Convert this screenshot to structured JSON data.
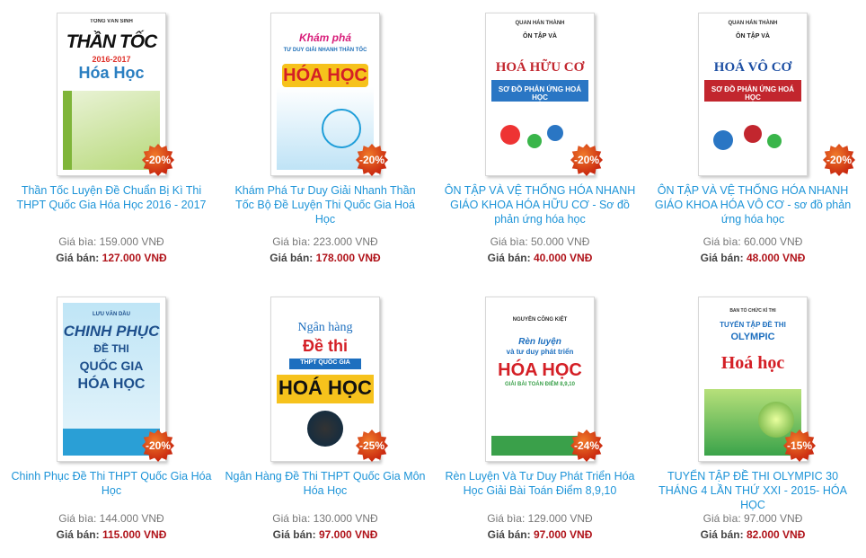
{
  "products": [
    {
      "title": "Thần Tốc Luyện Đề Chuẩn Bị Kì Thi THPT Quốc Gia Hóa Học 2016 - 2017",
      "discount": "-20%",
      "list_label": "Giá bìa:",
      "list_price": "159.000 VNĐ",
      "sale_label": "Giá bán:",
      "sale_price": "127.000 VNĐ",
      "cover": {
        "author": "TỐNG VĂN SINH",
        "main": "THẦN TỐC",
        "year": "2016-2017",
        "sub": "Hóa Học",
        "theme": "#7fb539"
      }
    },
    {
      "title": "Khám Phá Tư Duy Giải Nhanh Thần Tốc Bộ Đề Luyện Thi Quốc Gia Hoá Học",
      "discount": "-20%",
      "list_label": "Giá bìa:",
      "list_price": "223.000 VNĐ",
      "sale_label": "Giá bán:",
      "sale_price": "178.000 VNĐ",
      "cover": {
        "top": "Khám phá",
        "mid": "TƯ DUY GIẢI NHANH THẦN TỐC",
        "main": "HÓA HỌC",
        "theme": "#1f9ed9"
      }
    },
    {
      "title": "ÔN TẬP VÀ VỆ THỐNG HÓA NHANH GIÁO KHOA HÓA HỮU CƠ - Sơ đồ phản ứng hóa học",
      "discount": "-20%",
      "list_label": "Giá bìa:",
      "list_price": "50.000 VNĐ",
      "sale_label": "Giá bán:",
      "sale_price": "40.000 VNĐ",
      "cover": {
        "author": "QUAN HÁN THÀNH",
        "top": "ÔN TẬP VÀ",
        "main": "HOÁ HỮU CƠ",
        "sub": "SƠ ĐỒ PHẢN ỨNG HOÁ HỌC",
        "theme": "#2a76c4"
      }
    },
    {
      "title": "ÔN TẬP VÀ VỆ THỐNG HÓA NHANH GIÁO KHOA HÓA VÔ CƠ - sơ đồ phản ứng hóa học",
      "discount": "-20%",
      "list_label": "Giá bìa:",
      "list_price": "60.000 VNĐ",
      "sale_label": "Giá bán:",
      "sale_price": "48.000 VNĐ",
      "cover": {
        "author": "QUAN HÁN THÀNH",
        "top": "ÔN TẬP VÀ",
        "main": "HOÁ VÔ CƠ",
        "sub": "SƠ ĐỒ PHẢN ỨNG HOÁ HỌC",
        "theme": "#c2262e"
      }
    },
    {
      "title": "Chinh Phục Đề Thi THPT Quốc Gia Hóa Học",
      "discount": "-20%",
      "list_label": "Giá bìa:",
      "list_price": "144.000 VNĐ",
      "sale_label": "Giá bán:",
      "sale_price": "115.000 VNĐ",
      "cover": {
        "author": "LƯU VĂN DẦU",
        "main": "CHINH PHỤC",
        "mid": "ĐỀ THI",
        "sub": "QUỐC GIA",
        "bottom": "HÓA HỌC",
        "theme": "#2a9fd6"
      }
    },
    {
      "title": "Ngân Hàng Đề Thi THPT Quốc Gia Môn Hóa Học",
      "discount": "-25%",
      "list_label": "Giá bìa:",
      "list_price": "130.000 VNĐ",
      "sale_label": "Giá bán:",
      "sale_price": "97.000 VNĐ",
      "cover": {
        "top": "Ngân hàng",
        "mid": "Đề thi",
        "sub": "THPT QUỐC GIA",
        "main": "HOÁ HỌC",
        "theme": "#1d6fbf"
      }
    },
    {
      "title": "Rèn Luyện Và Tư Duy Phát Triển Hóa Học Giải Bài Toán Điểm 8,9,10",
      "discount": "-24%",
      "list_label": "Giá bìa:",
      "list_price": "129.000 VNĐ",
      "sale_label": "Giá bán:",
      "sale_price": "97.000 VNĐ",
      "cover": {
        "author": "NGUYỄN CÔNG KIỆT",
        "top": "Rèn luyện",
        "mid": "và tư duy phát triển",
        "main": "HÓA HỌC",
        "sub": "GIẢI BÀI TOÁN ĐIỂM 8,9,10",
        "theme": "#3aa04a"
      }
    },
    {
      "title": "TUYỂN TẬP ĐỀ THI OLYMPIC 30 THÁNG 4 LẦN THỨ XXI - 2015- HÓA HỌC",
      "discount": "-15%",
      "list_label": "Giá bìa:",
      "list_price": "97.000 VNĐ",
      "sale_label": "Giá bán:",
      "sale_price": "82.000 VNĐ",
      "cover": {
        "author": "BAN TỔ CHỨC KÌ THI",
        "top": "TUYỂN TẬP ĐỀ THI",
        "mid": "OLYMPIC",
        "main": "Hoá học",
        "theme": "#3aa34a"
      }
    }
  ]
}
